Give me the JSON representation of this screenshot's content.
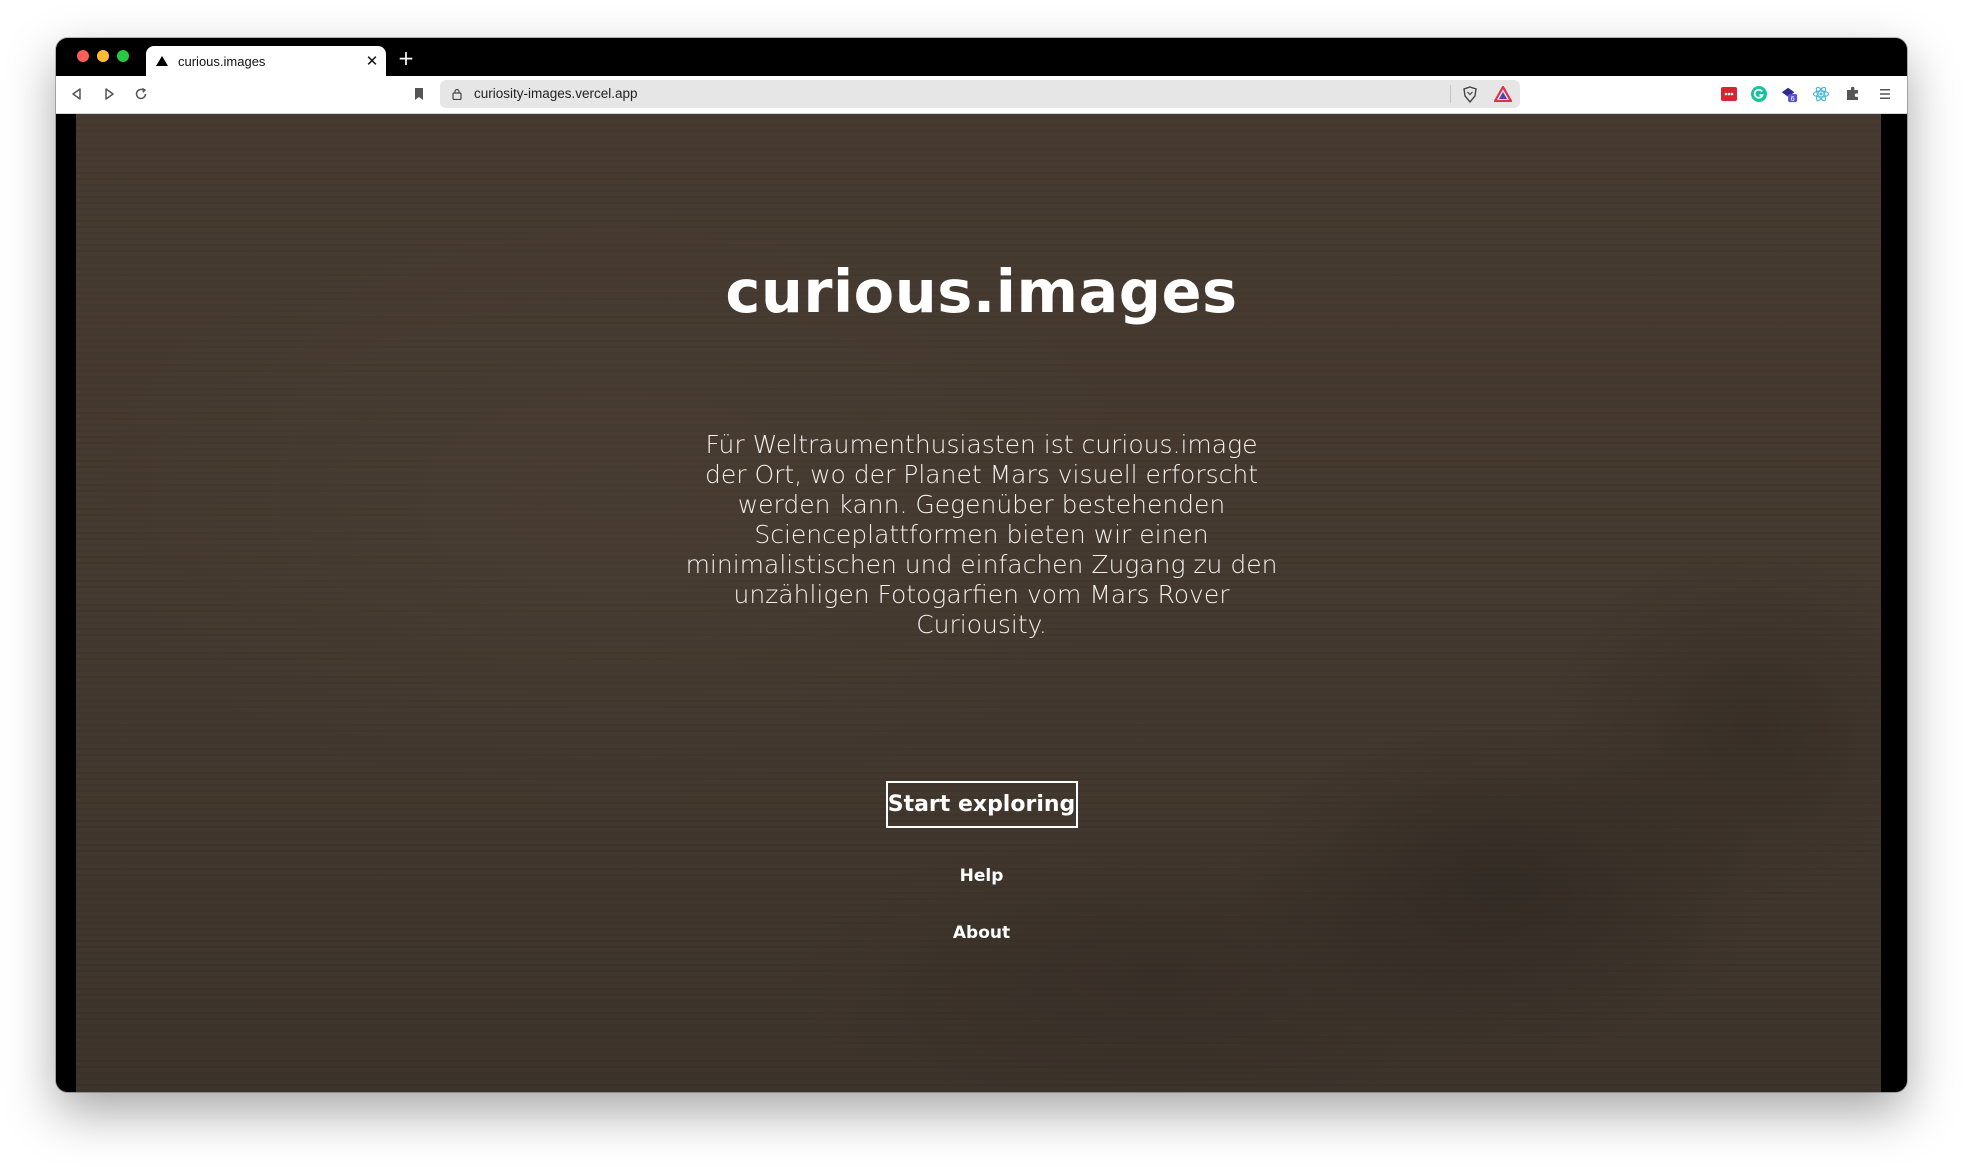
{
  "browser": {
    "tab_title": "curious.images",
    "tab_close_glyph": "✕",
    "new_tab_glyph": "+",
    "url": "curiosity-images.vercel.app",
    "icons": [
      "back-icon",
      "forward-icon",
      "reload-icon",
      "bookmark-icon",
      "lock-icon",
      "brave-shield-icon",
      "brave-rewards-icon",
      "extension-red-icon",
      "grammarly-icon",
      "extension-badge-icon",
      "react-devtools-icon",
      "extensions-puzzle-icon",
      "menu-icon"
    ],
    "extension_badge_count": "6",
    "colors": {
      "close": "#fe5f57",
      "minimize": "#febc2e",
      "zoom": "#28c840"
    }
  },
  "page": {
    "title": "curious.images",
    "tagline": "Für Weltraumenthusiasten ist curious.image der Ort, wo der Planet Mars visuell erforscht werden kann. Gegenüber bestehenden Scienceplattformen bieten wir einen minimalistischen und einfachen Zugang zu den unzähligen Fotogarfien vom Mars Rover Curiousity.",
    "cta_label": "Start exploring",
    "help_label": "Help",
    "about_label": "About",
    "background_color": "#453a30"
  }
}
